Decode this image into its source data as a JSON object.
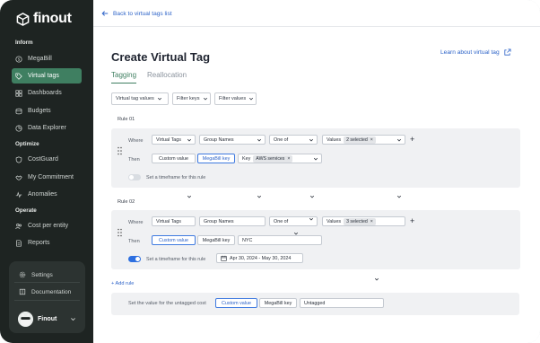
{
  "sidebar": {
    "logo_text": "finout",
    "sections": {
      "inform": "Inform",
      "optimize": "Optimize",
      "operate": "Operate"
    },
    "items": [
      {
        "label": "MegaBill",
        "icon": "dollar-circle-icon",
        "active": false
      },
      {
        "label": "Virtual tags",
        "icon": "tag-icon",
        "active": true
      },
      {
        "label": "Dashboards",
        "icon": "grid-icon",
        "active": false
      },
      {
        "label": "Budgets",
        "icon": "coins-icon",
        "active": false
      },
      {
        "label": "Data Explorer",
        "icon": "database-icon",
        "active": false
      },
      {
        "label": "CostGuard",
        "icon": "shield-icon",
        "active": false
      },
      {
        "label": "My Commitment",
        "icon": "handshake-icon",
        "active": false
      },
      {
        "label": "Anomalies",
        "icon": "pulse-icon",
        "active": false
      },
      {
        "label": "Cost per entity",
        "icon": "users-icon",
        "active": false
      },
      {
        "label": "Reports",
        "icon": "document-icon",
        "active": false
      }
    ],
    "bottom": {
      "settings": "Settings",
      "documentation": "Documentation",
      "user_name": "Finout"
    }
  },
  "header": {
    "back_link": "Back to virtual tags list",
    "title": "Create Virtual Tag",
    "learn_link": "Learn about virtual tag"
  },
  "tabs": [
    {
      "label": "Tagging",
      "active": true
    },
    {
      "label": "Reallocation",
      "active": false
    }
  ],
  "filters": [
    "Virtual tag values",
    "Filter keys",
    "Filter values"
  ],
  "rules": [
    {
      "label": "Rule 01",
      "where_label": "Where",
      "then_label": "Then",
      "where": {
        "source": "Virtual Tags",
        "key": "Group Names",
        "operator": "One of",
        "values_label": "Values",
        "values_chip": "2 selected"
      },
      "then": {
        "custom_value": "Custom value",
        "megabill_key": "MegaBill key",
        "selected": "megabill_key",
        "key_label": "Key",
        "key_chip": "AWS services"
      },
      "timeframe_label": "Set a timeframe for this rule",
      "timeframe_on": false
    },
    {
      "label": "Rule 02",
      "where_label": "Where",
      "then_label": "Then",
      "where": {
        "source": "Virtual Tags",
        "key": "Group Names",
        "operator": "One of",
        "values_label": "Values",
        "values_chip": "3 selected"
      },
      "then": {
        "custom_value": "Custom value",
        "megabill_key": "MegaBill key",
        "selected": "custom_value",
        "value": "NYC"
      },
      "timeframe_label": "Set a timeframe for this rule",
      "timeframe_on": true,
      "timeframe_range": "Apr 30, 2024 - May 30, 2024"
    }
  ],
  "add_rule": "+ Add rule",
  "untagged": {
    "label": "Set the value for the untagged cost",
    "custom_value": "Custom value",
    "megabill_key": "MegaBill key",
    "selected": "custom_value",
    "value": "Untagged"
  },
  "colors": {
    "sidebar_bg": "#1e2422",
    "accent_green": "#3f7f61",
    "link_blue": "#2d63c8",
    "toggle_on": "#2d6fe0"
  }
}
